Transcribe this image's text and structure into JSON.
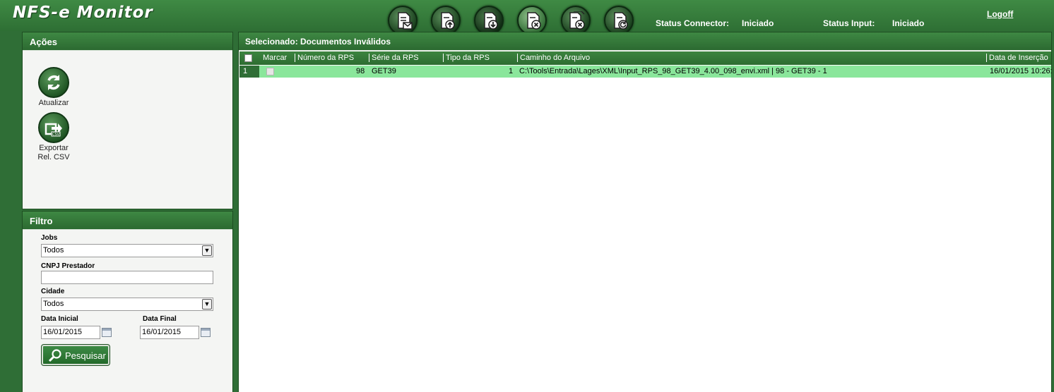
{
  "app": {
    "title": "NFS-e Monitor"
  },
  "toolbar": {
    "buttons": [
      {
        "icon": "document-mail-icon",
        "name": "documents-sent"
      },
      {
        "icon": "document-upload-icon",
        "name": "documents-upload"
      },
      {
        "icon": "document-download-icon",
        "name": "documents-download"
      },
      {
        "icon": "document-invalid-icon",
        "name": "documents-invalid"
      },
      {
        "icon": "document-cancel-icon",
        "name": "documents-cancelled"
      },
      {
        "icon": "document-refresh-icon",
        "name": "documents-reprocess"
      }
    ]
  },
  "status": {
    "connector_label": "Status Connector:",
    "connector_value": "Iniciado",
    "input_label": "Status Input:",
    "input_value": "Iniciado"
  },
  "logoff_label": "Logoff",
  "acoes": {
    "title": "Ações",
    "refresh_label": "Atualizar",
    "export_label_line1": "Exportar",
    "export_label_line2": "Rel. CSV"
  },
  "filtro": {
    "title": "Filtro",
    "jobs_label": "Jobs",
    "jobs_value": "Todos",
    "cnpj_label": "CNPJ Prestador",
    "cnpj_value": "",
    "cidade_label": "Cidade",
    "cidade_value": "Todos",
    "data_inicial_label": "Data Inicial",
    "data_inicial_value": "16/01/2015",
    "data_final_label": "Data Final",
    "data_final_value": "16/01/2015",
    "search_label": "Pesquisar"
  },
  "main": {
    "title": "Selecionado: Documentos Inválidos",
    "columns": [
      "Marcar",
      "Número da RPS",
      "Série da RPS",
      "Tipo da RPS",
      "Caminho do Arquivo",
      "Data de Inserção"
    ],
    "rows": [
      {
        "index": "1",
        "numero": "98",
        "serie": "GET39",
        "tipo": "1",
        "caminho": "C:\\Tools\\Entrada\\Lages\\XML\\Input_RPS_98_GET39_4.00_098_envi.xml | 98 - GET39 - 1",
        "data": "16/01/2015 10:26:"
      }
    ]
  },
  "colors": {
    "brand_green": "#2f6e36",
    "row_highlight": "#8ae69b",
    "panel_bg": "#f4f5f3"
  }
}
